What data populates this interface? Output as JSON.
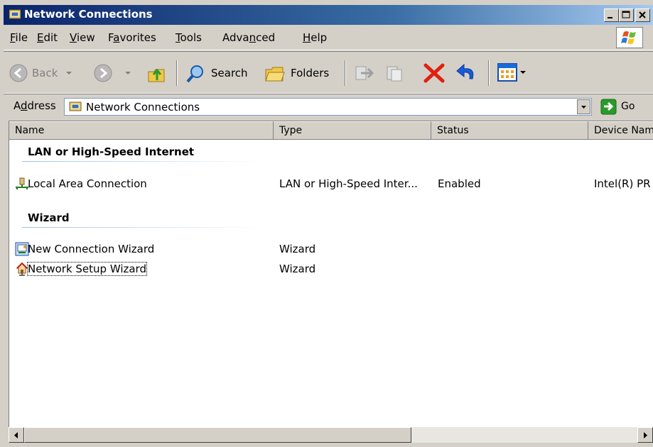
{
  "window": {
    "title": "Network Connections",
    "controls": [
      "minimize",
      "maximize",
      "close"
    ]
  },
  "menu": {
    "items": [
      {
        "pre": "",
        "u": "F",
        "post": "ile"
      },
      {
        "pre": "",
        "u": "E",
        "post": "dit"
      },
      {
        "pre": "",
        "u": "V",
        "post": "iew"
      },
      {
        "pre": "F",
        "u": "a",
        "post": "vorites"
      },
      {
        "pre": "",
        "u": "T",
        "post": "ools"
      },
      {
        "pre": "Adva",
        "u": "n",
        "post": "ced"
      },
      {
        "pre": "",
        "u": "H",
        "post": "elp"
      }
    ]
  },
  "toolbar": {
    "back_label": "Back",
    "search_label": "Search",
    "folders_label": "Folders"
  },
  "address": {
    "label_pre": "A",
    "label_u": "d",
    "label_post": "dress",
    "value": "Network Connections",
    "go_label": "Go"
  },
  "columns": [
    "Name",
    "Type",
    "Status",
    "Device Nam"
  ],
  "groups": [
    {
      "title": "LAN or High-Speed Internet",
      "items": [
        {
          "name": "Local Area Connection",
          "type": "LAN or High-Speed Inter...",
          "status": "Enabled",
          "device": "Intel(R) PR",
          "icon": "network-connection-icon"
        }
      ]
    },
    {
      "title": "Wizard",
      "items": [
        {
          "name": "New Connection Wizard",
          "type": "Wizard",
          "status": "",
          "device": "",
          "icon": "new-connection-wizard-icon"
        },
        {
          "name": "Network Setup Wizard",
          "type": "Wizard",
          "status": "",
          "device": "",
          "icon": "network-setup-wizard-icon"
        }
      ]
    }
  ],
  "colors": {
    "titlebar_start": "#0a246a",
    "titlebar_end": "#a6caf0",
    "face": "#d4d0c8"
  }
}
